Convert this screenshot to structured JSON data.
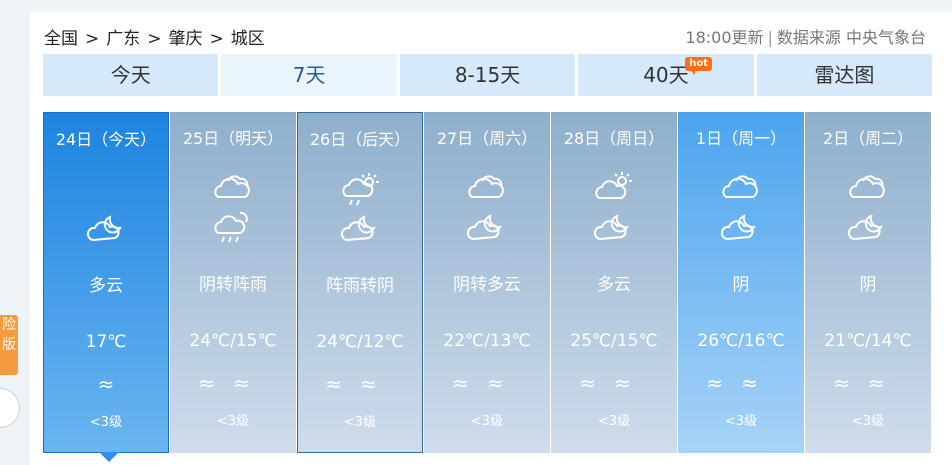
{
  "breadcrumb": [
    "全国",
    "广东",
    "肇庆",
    "城区"
  ],
  "breadcrumb_sep": ">",
  "meta": {
    "updated": "18:00更新",
    "source": "数据来源 中央气象台"
  },
  "tabs": [
    {
      "label": "今天"
    },
    {
      "label": "7天"
    },
    {
      "label": "8-15天"
    },
    {
      "label": "40天",
      "badge": "hot"
    },
    {
      "label": "雷达图"
    }
  ],
  "days": [
    {
      "date": "24日（今天）",
      "icon1": "",
      "icon2": "partly-cloudy-night-icon",
      "condition": "多云",
      "temp": "17℃",
      "wind": "≈",
      "level": "<3级"
    },
    {
      "date": "25日（明天）",
      "icon1": "cloudy-icon",
      "icon2": "shower-rain-icon",
      "condition": "阴转阵雨",
      "temp": "24℃/15℃",
      "wind": "≈≈",
      "level": "<3级"
    },
    {
      "date": "26日（后天）",
      "icon1": "shower-rain-icon",
      "icon2": "partly-cloudy-night-icon",
      "condition": "阵雨转阴",
      "temp": "24℃/12℃",
      "wind": "≈≈",
      "level": "<3级"
    },
    {
      "date": "27日（周六）",
      "icon1": "cloudy-icon",
      "icon2": "partly-cloudy-night-icon",
      "condition": "阴转多云",
      "temp": "22℃/13℃",
      "wind": "≈≈",
      "level": "<3级"
    },
    {
      "date": "28日（周日）",
      "icon1": "partly-cloudy-day-icon",
      "icon2": "partly-cloudy-night-icon",
      "condition": "多云",
      "temp": "25℃/15℃",
      "wind": "≈≈",
      "level": "<3级"
    },
    {
      "date": "1日（周一）",
      "icon1": "cloudy-icon",
      "icon2": "partly-cloudy-night-icon",
      "condition": "阴",
      "temp": "26℃/16℃",
      "wind": "≈≈",
      "level": "<3级"
    },
    {
      "date": "2日（周二）",
      "icon1": "cloudy-icon",
      "icon2": "partly-cloudy-night-icon",
      "condition": "阴",
      "temp": "21℃/14℃",
      "wind": "≈≈",
      "level": "<3级"
    }
  ],
  "sidebar": {
    "label": "险 版"
  }
}
